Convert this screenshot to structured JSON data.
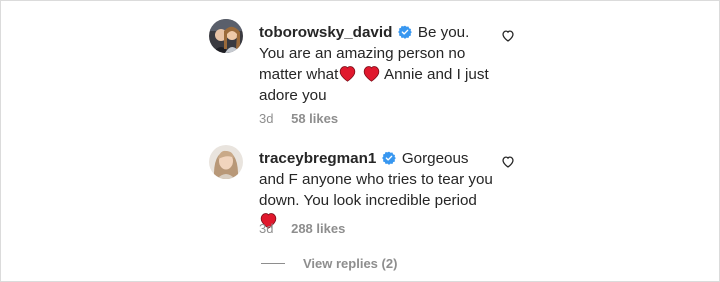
{
  "comments": [
    {
      "username": "toborowsky_david",
      "text_a": "Be you. You are an amazing person no matter what",
      "text_b": "Annie and I just adore you",
      "time": "3d",
      "likes": "58 likes"
    },
    {
      "username": "traceybregman1",
      "text_a": "Gorgeous and F anyone who tries to tear you down. You look incredible period",
      "time": "3d",
      "likes": "288 likes"
    }
  ],
  "view_replies": "View replies (2)",
  "colors": {
    "verified": "#3897f0",
    "heart": "#e0182d",
    "muted": "#8e8e8e"
  }
}
